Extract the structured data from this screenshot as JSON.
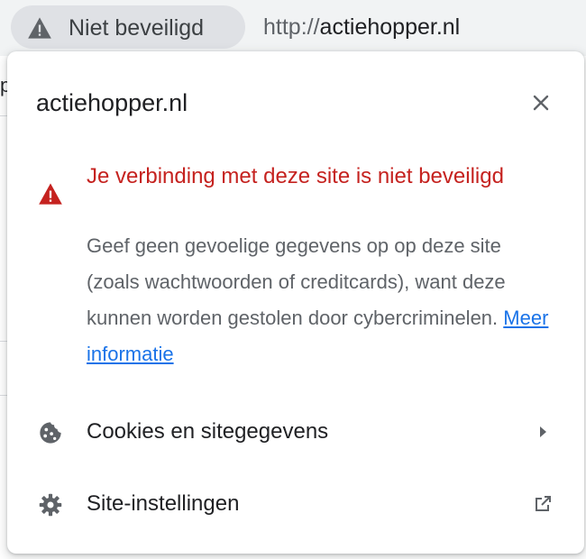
{
  "address_bar": {
    "security_chip_label": "Niet beveiligd",
    "url_scheme": "http://",
    "url_host": "actiehopper.nl"
  },
  "background_page": {
    "peek_letter": "p"
  },
  "popup": {
    "title": "actiehopper.nl",
    "warning_title": "Je verbinding met deze site is niet beveiligd",
    "warning_body": "Geef geen gevoelige gegevens op op deze site (zoals wachtwoorden of creditcards), want deze kunnen worden gestolen door cybercriminelen.",
    "learn_more_label": "Meer informatie",
    "rows": [
      {
        "label": "Cookies en sitegegevens",
        "icon": "cookie-icon",
        "trailing_icon": "arrow-right-icon"
      },
      {
        "label": "Site-instellingen",
        "icon": "gear-icon",
        "trailing_icon": "open-in-new-icon"
      }
    ]
  },
  "colors": {
    "warning_red": "#c5221f",
    "link_blue": "#1a73e8",
    "chip_bg": "#dfe1e5",
    "text_secondary": "#5f6368"
  }
}
